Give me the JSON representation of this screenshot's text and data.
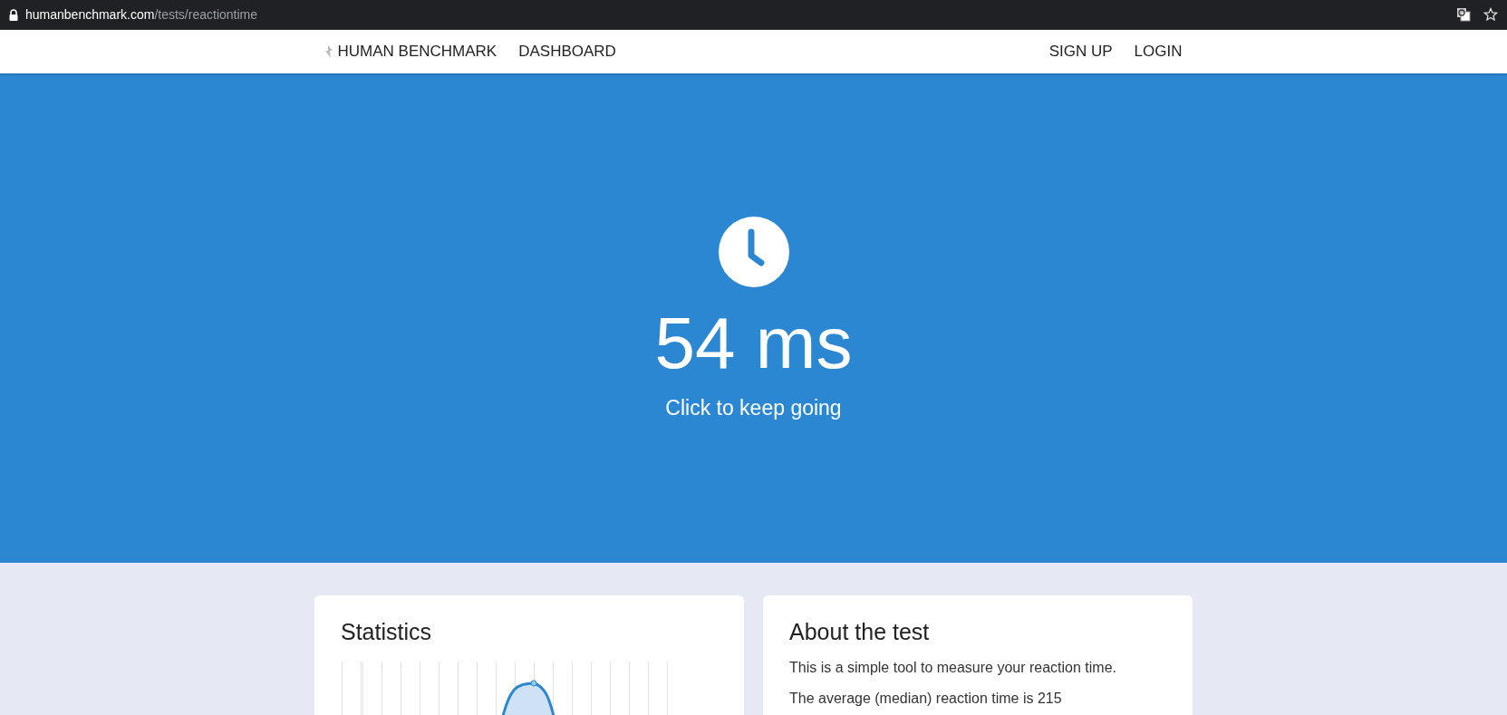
{
  "browser": {
    "url_host": "humanbenchmark.com",
    "url_path": "/tests/reactiontime"
  },
  "nav": {
    "brand": "HUMAN BENCHMARK",
    "links": [
      "DASHBOARD"
    ],
    "account": [
      "SIGN UP",
      "LOGIN"
    ]
  },
  "hero": {
    "result": "54 ms",
    "prompt": "Click to keep going"
  },
  "statistics": {
    "title": "Statistics"
  },
  "about": {
    "title": "About the test",
    "paragraphs": [
      "This is a simple tool to measure your reaction time.",
      "The average (median) reaction time is 215"
    ]
  }
}
